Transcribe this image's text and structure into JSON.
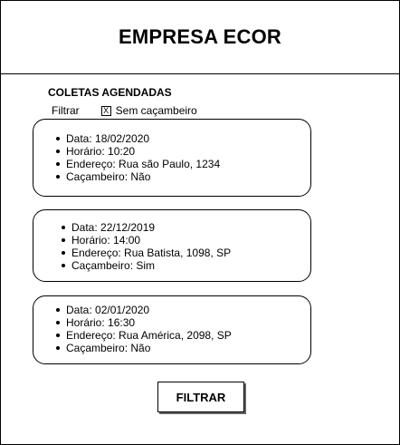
{
  "header": {
    "title": "EMPRESA ECOR"
  },
  "section": {
    "title": "COLETAS AGENDADAS"
  },
  "filter": {
    "label": "Filtrar",
    "checkbox_mark": "X",
    "checkbox_label": "Sem caçambeiro",
    "checked": true
  },
  "cards": [
    {
      "data": "Data: 18/02/2020",
      "horario": "Horário: 10:20",
      "endereco": "Endereço: Rua são Paulo, 1234",
      "cacambeiro": "Caçambeiro: Não"
    },
    {
      "data": "Data: 22/12/2019",
      "horario": "Horário: 14:00",
      "endereco": "Endereço: Rua Batista, 1098, SP",
      "cacambeiro": "Caçambeiro: Sim"
    },
    {
      "data": "Data: 02/01/2020",
      "horario": "Horário: 16:30",
      "endereco": "Endereço: Rua América, 2098, SP",
      "cacambeiro": "Caçambeiro: Não"
    }
  ],
  "button": {
    "label": "FILTRAR"
  }
}
